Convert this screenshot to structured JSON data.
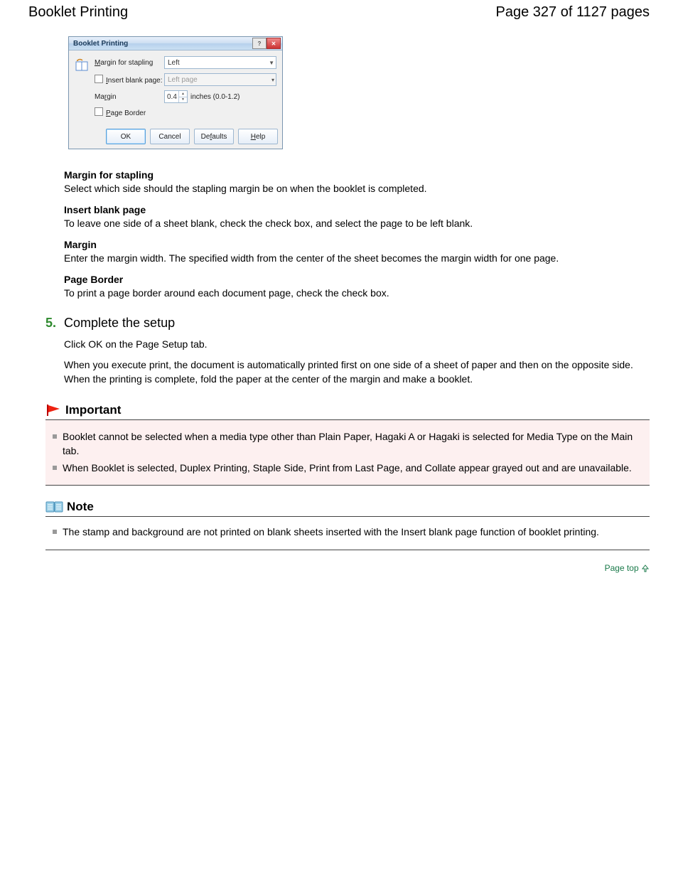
{
  "header": {
    "title": "Booklet Printing",
    "page_label": "Page 327 of 1127 pages"
  },
  "dialog": {
    "title": "Booklet Printing",
    "labels": {
      "margin_for_stapling_pre": "M",
      "margin_for_stapling_rest": "argin for stapling",
      "insert_blank_pre": "I",
      "insert_blank_rest": "nsert blank page:",
      "margin_pre": "Ma",
      "margin_underline": "r",
      "margin_rest": "gin",
      "page_border_pre": "P",
      "page_border_rest": "age Border"
    },
    "values": {
      "stapling_side": "Left",
      "blank_page": "Left page",
      "margin_value": "0.4",
      "margin_range": "inches (0.0-1.2)"
    },
    "buttons": {
      "ok": "OK",
      "cancel": "Cancel",
      "defaults_pre": "De",
      "defaults_underline": "f",
      "defaults_rest": "aults",
      "help_pre": "",
      "help_underline": "H",
      "help_rest": "elp"
    }
  },
  "descriptions": [
    {
      "term": "Margin for stapling",
      "def": "Select which side should the stapling margin be on when the booklet is completed."
    },
    {
      "term": "Insert blank page",
      "def": "To leave one side of a sheet blank, check the check box, and select the page to be left blank."
    },
    {
      "term": "Margin",
      "def": "Enter the margin width. The specified width from the center of the sheet becomes the margin width for one page."
    },
    {
      "term": "Page Border",
      "def": "To print a page border around each document page, check the check box."
    }
  ],
  "step": {
    "num": "5.",
    "title": "Complete the setup",
    "lines": [
      "Click OK on the Page Setup tab.",
      "When you execute print, the document is automatically printed first on one side of a sheet of paper and then on the opposite side.",
      "When the printing is complete, fold the paper at the center of the margin and make a booklet."
    ]
  },
  "important": {
    "title": "Important",
    "items": [
      "Booklet cannot be selected when a media type other than Plain Paper, Hagaki A or Hagaki is selected for Media Type on the Main tab.",
      "When Booklet is selected, Duplex Printing, Staple Side, Print from Last Page, and Collate appear grayed out and are unavailable."
    ]
  },
  "note": {
    "title": "Note",
    "items": [
      "The stamp and background are not printed on blank sheets inserted with the Insert blank page function of booklet printing."
    ]
  },
  "pagetop_label": "Page top"
}
